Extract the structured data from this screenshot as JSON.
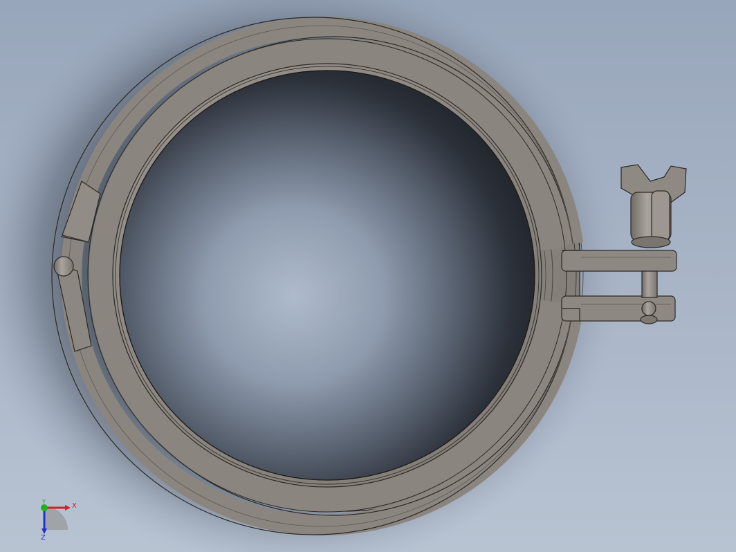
{
  "viewport": {
    "background": {
      "top_color": "#98a6bb",
      "bottom_color": "#b7c2d1",
      "shadow_color": "#1f2329"
    }
  },
  "model": {
    "part_name": "tri-clamp-with-wing-nut",
    "body_color": "#8d8781",
    "edge_color": "#2b2926"
  },
  "triad": {
    "x_label": "X",
    "y_label": "Y",
    "z_label": "Z",
    "x_color": "#d42020",
    "y_color": "#1fb21f",
    "z_color": "#2030d0"
  }
}
